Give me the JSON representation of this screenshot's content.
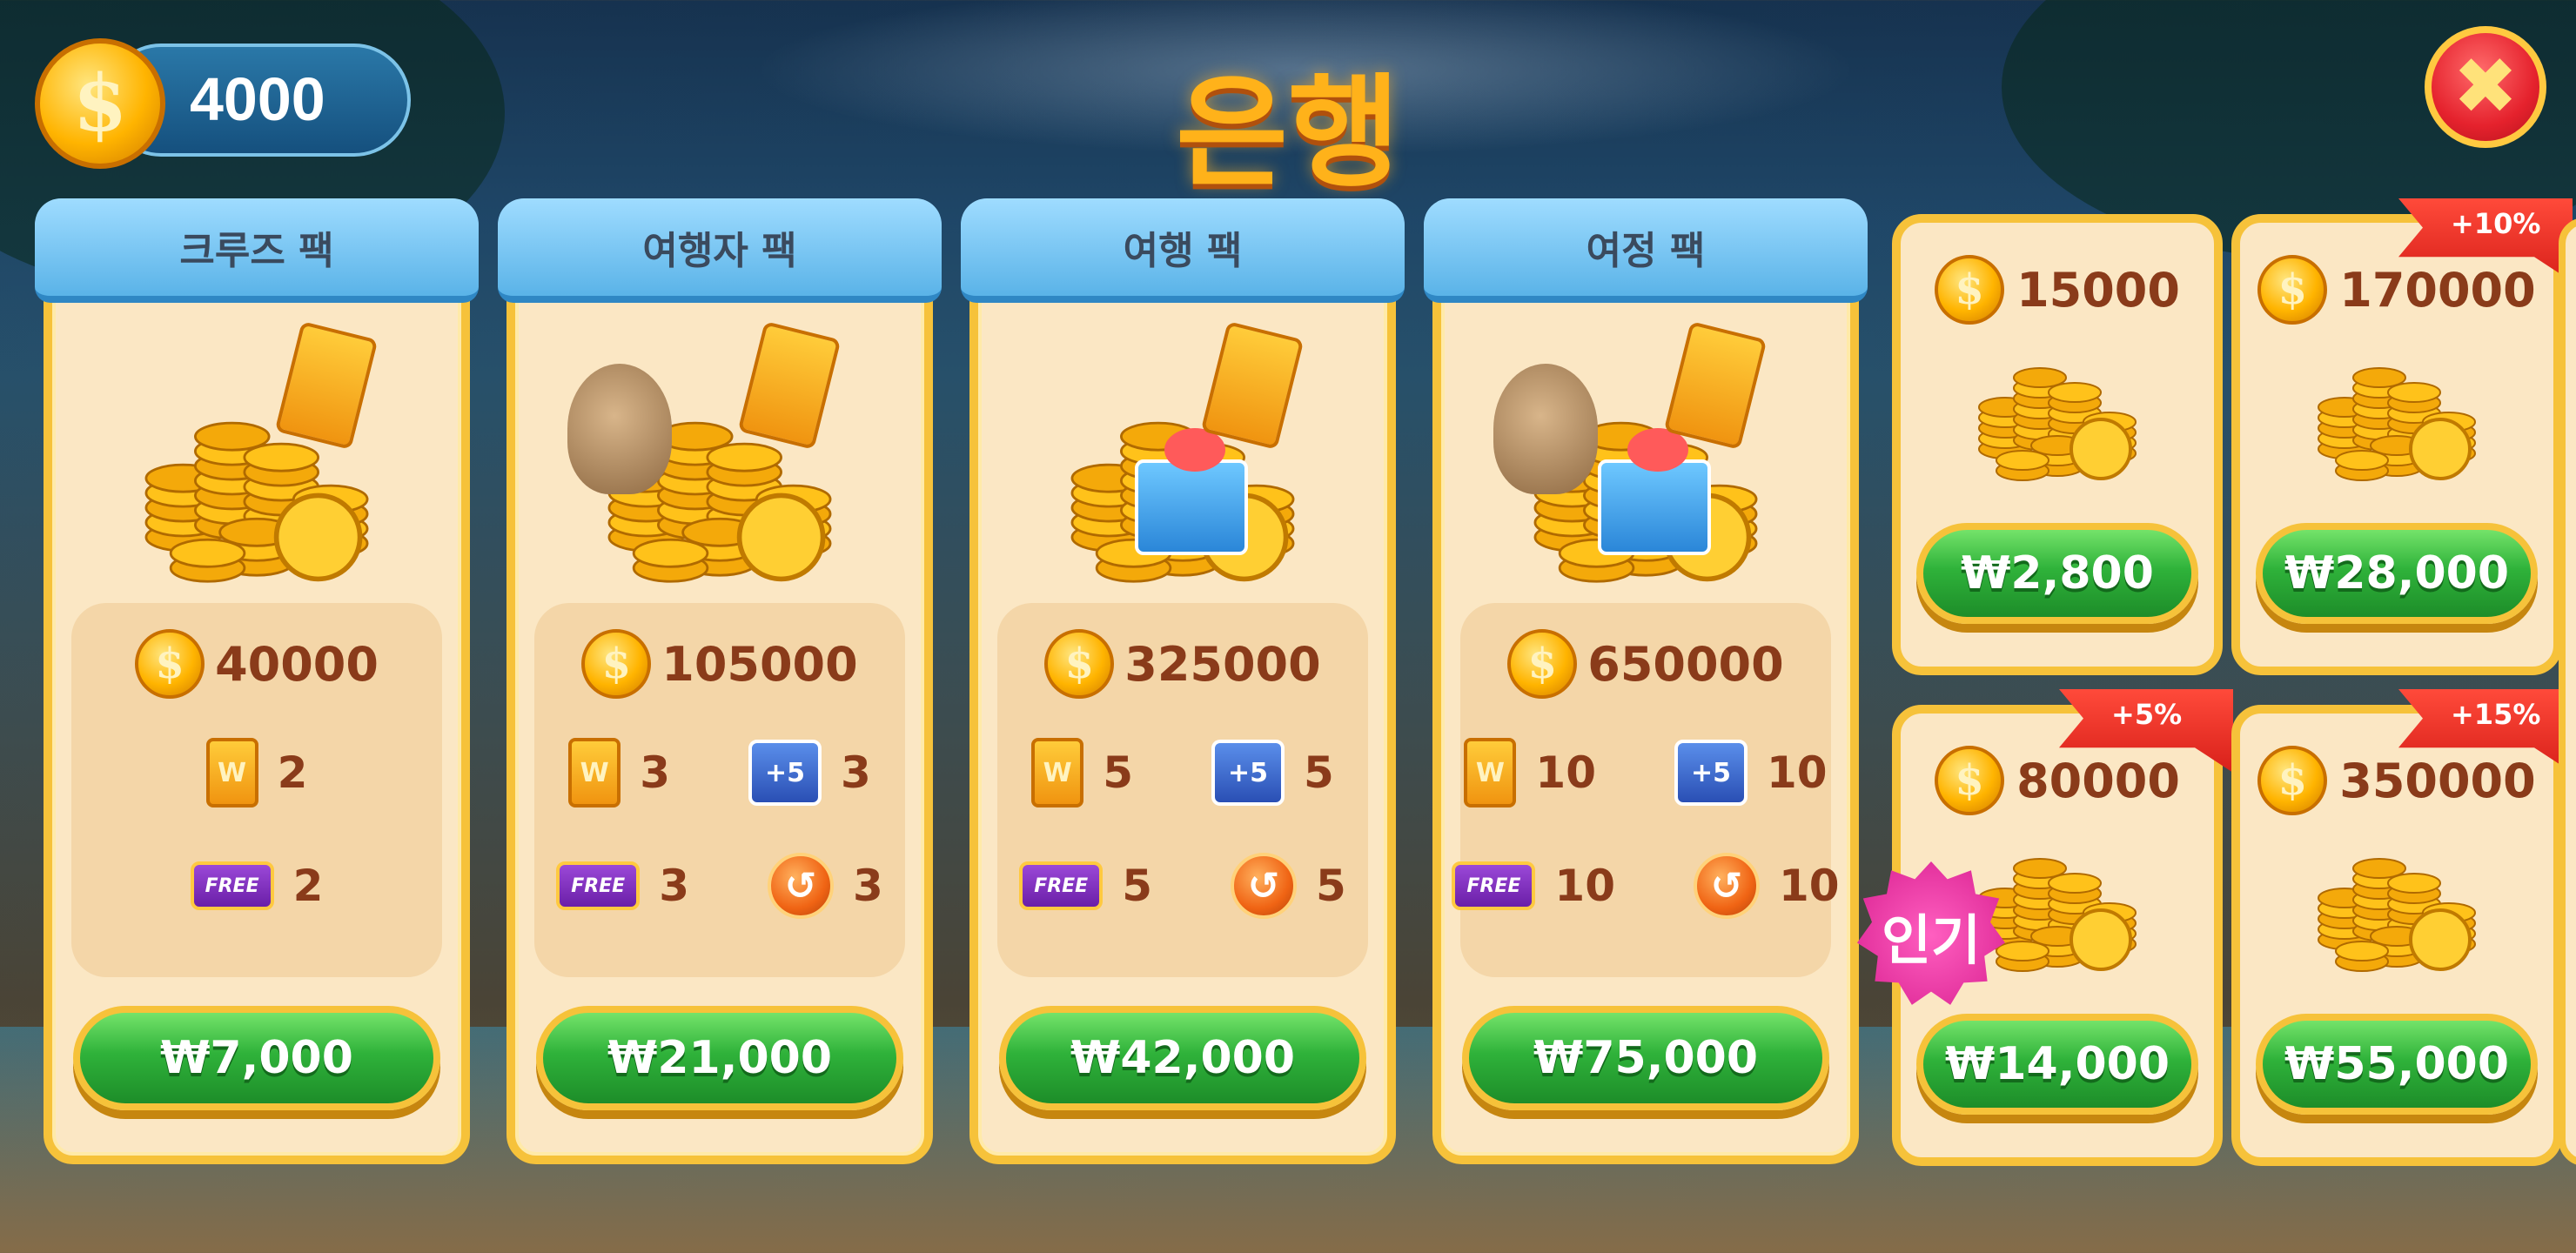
{
  "header": {
    "coin_balance": "4000",
    "coin_symbol": "$",
    "title": "은행",
    "close_symbol": "✖"
  },
  "packs": [
    {
      "name": "크루즈 팩",
      "coins": "40000",
      "items": {
        "wild_card": "2",
        "plus5": null,
        "free_ticket": "2",
        "undo": null
      },
      "price": "₩7,000"
    },
    {
      "name": "여행자 팩",
      "coins": "105000",
      "items": {
        "wild_card": "3",
        "plus5": "3",
        "free_ticket": "3",
        "undo": "3"
      },
      "price": "₩21,000"
    },
    {
      "name": "여행 팩",
      "coins": "325000",
      "items": {
        "wild_card": "5",
        "plus5": "5",
        "free_ticket": "5",
        "undo": "5"
      },
      "price": "₩42,000"
    },
    {
      "name": "여정 팩",
      "coins": "650000",
      "items": {
        "wild_card": "10",
        "plus5": "10",
        "free_ticket": "10",
        "undo": "10"
      },
      "price": "₩75,000"
    }
  ],
  "coin_packs": [
    {
      "coins": "15000",
      "price": "₩2,800",
      "bonus": null,
      "popular": false
    },
    {
      "coins": "170000",
      "price": "₩28,000",
      "bonus": "+10%",
      "popular": false
    },
    {
      "coins": "80000",
      "price": "₩14,000",
      "bonus": "+5%",
      "popular": true
    },
    {
      "coins": "350000",
      "price": "₩55,000",
      "bonus": "+15%",
      "popular": false
    }
  ],
  "labels": {
    "popular": "인기",
    "free": "FREE",
    "plus5": "+5",
    "wild": "W",
    "undo": "↺"
  },
  "colors": {
    "panel": "#fbe7c4",
    "panel_border": "#f6c23a",
    "ribbon": "#5ab3e8",
    "buy_button": "#2fb23a",
    "title": "#ffb21a",
    "bonus_flag": "#d8201a",
    "popular_badge": "#d81f8f"
  },
  "icons": {
    "coin": "coin-icon",
    "wild_card": "wild-card-icon",
    "free_ticket": "free-ticket-icon",
    "plus5": "plus5-cards-icon",
    "undo": "undo-icon",
    "close": "close-icon"
  }
}
